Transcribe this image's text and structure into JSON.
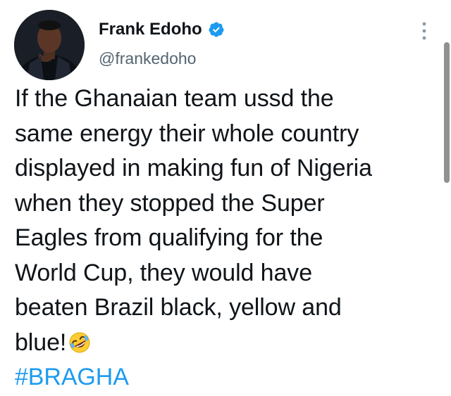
{
  "author": {
    "display_name": "Frank Edoho",
    "handle": "@frankedoho",
    "verified": true,
    "avatar_icon": "profile-photo"
  },
  "tweet": {
    "lines": [
      "If the Ghanaian team ussd the",
      "same energy their whole country",
      "displayed in making fun of Nigeria",
      "when they stopped the Super",
      "Eagles from qualifying for the",
      "World Cup, they would have",
      "beaten Brazil black, yellow and",
      "blue!"
    ],
    "emoji": "rolling-on-the-floor-laughing-emoji",
    "hashtag": "#BRAGHA"
  },
  "icons": {
    "verified": "verified-badge-icon",
    "more": "more-options-icon"
  },
  "colors": {
    "text": "#0f1419",
    "secondary": "#536471",
    "link": "#1d9bf0",
    "verified": "#1d9bf0"
  }
}
